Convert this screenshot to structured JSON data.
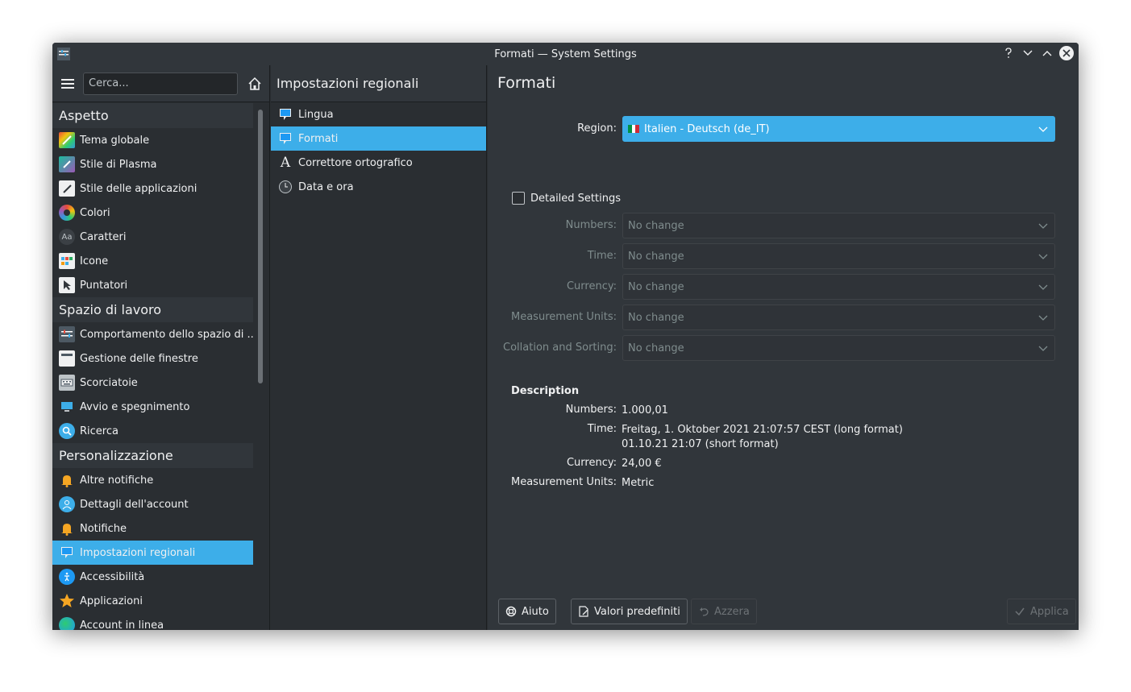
{
  "window": {
    "title": "Formati — System Settings",
    "accent": "#3daee9"
  },
  "sidebar": {
    "search_placeholder": "Cerca...",
    "categories": [
      {
        "label": "Aspetto",
        "items": [
          {
            "label": "Tema globale",
            "icon": "global-theme-icon"
          },
          {
            "label": "Stile di Plasma",
            "icon": "plasma-style-icon"
          },
          {
            "label": "Stile delle applicazioni",
            "icon": "app-style-icon"
          },
          {
            "label": "Colori",
            "icon": "colors-icon"
          },
          {
            "label": "Caratteri",
            "icon": "fonts-icon"
          },
          {
            "label": "Icone",
            "icon": "icons-icon"
          },
          {
            "label": "Puntatori",
            "icon": "cursors-icon"
          }
        ]
      },
      {
        "label": "Spazio di lavoro",
        "items": [
          {
            "label": "Comportamento dello spazio di ...",
            "icon": "workspace-behavior-icon"
          },
          {
            "label": "Gestione delle finestre",
            "icon": "window-management-icon"
          },
          {
            "label": "Scorciatoie",
            "icon": "shortcuts-icon"
          },
          {
            "label": "Avvio e spegnimento",
            "icon": "startup-shutdown-icon"
          },
          {
            "label": "Ricerca",
            "icon": "search-icon"
          }
        ]
      },
      {
        "label": "Personalizzazione",
        "items": [
          {
            "label": "Altre notifiche",
            "icon": "bell-icon"
          },
          {
            "label": "Dettagli dell'account",
            "icon": "user-icon"
          },
          {
            "label": "Notifiche",
            "icon": "bell-icon"
          },
          {
            "label": "Impostazioni regionali",
            "icon": "regional-icon",
            "selected": true
          },
          {
            "label": "Accessibilità",
            "icon": "accessibility-icon"
          },
          {
            "label": "Applicazioni",
            "icon": "star-icon"
          },
          {
            "label": "Account in linea",
            "icon": "globe-icon"
          }
        ]
      }
    ]
  },
  "middle": {
    "header": "Impostazioni regionali",
    "items": [
      {
        "label": "Lingua",
        "icon": "language-icon"
      },
      {
        "label": "Formati",
        "icon": "formats-icon",
        "selected": true
      },
      {
        "label": "Correttore ortografico",
        "icon": "spellcheck-icon"
      },
      {
        "label": "Data e ora",
        "icon": "clock-icon"
      }
    ]
  },
  "content": {
    "title": "Formati",
    "region_label": "Region:",
    "region_value": "Italien - Deutsch (de_IT)",
    "detailed_settings_label": "Detailed Settings",
    "detailed_settings_checked": false,
    "fields": [
      {
        "label": "Numbers:",
        "value": "No change"
      },
      {
        "label": "Time:",
        "value": "No change"
      },
      {
        "label": "Currency:",
        "value": "No change"
      },
      {
        "label": "Measurement Units:",
        "value": "No change"
      },
      {
        "label": "Collation and Sorting:",
        "value": "No change"
      }
    ],
    "description": {
      "title": "Description",
      "numbers_label": "Numbers:",
      "numbers_value": "1.000,01",
      "time_label": "Time:",
      "time_long": "Freitag, 1. Oktober 2021 21:07:57 CEST (long format)",
      "time_short": "01.10.21 21:07 (short format)",
      "currency_label": "Currency:",
      "currency_value": "24,00 €",
      "units_label": "Measurement Units:",
      "units_value": "Metric"
    }
  },
  "buttons": {
    "help": "Aiuto",
    "defaults": "Valori predefiniti",
    "reset": "Azzera",
    "apply": "Applica"
  }
}
